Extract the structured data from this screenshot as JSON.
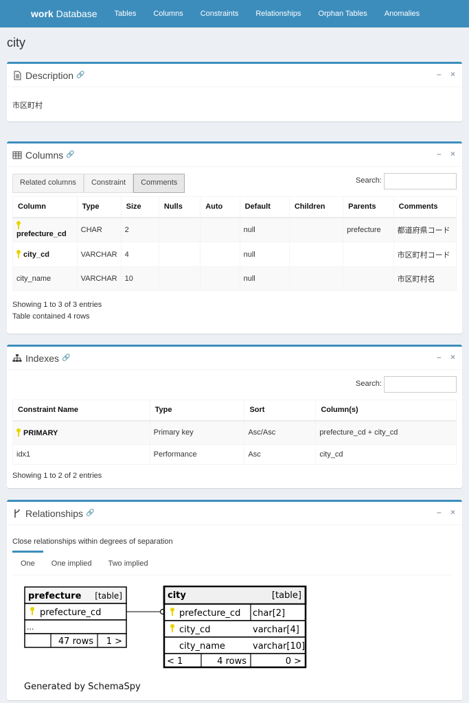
{
  "nav": {
    "brand_bold": "work",
    "brand_rest": " Database",
    "items": [
      "Tables",
      "Columns",
      "Constraints",
      "Relationships",
      "Orphan Tables",
      "Anomalies"
    ]
  },
  "page_title": "city",
  "description": {
    "title": "Description",
    "text": "市区町村"
  },
  "columns": {
    "title": "Columns",
    "buttons": [
      "Related columns",
      "Constraint",
      "Comments"
    ],
    "active_button": "Comments",
    "search_label": "Search:",
    "headers": [
      "Column",
      "Type",
      "Size",
      "Nulls",
      "Auto",
      "Default",
      "Children",
      "Parents",
      "Comments"
    ],
    "rows": [
      {
        "column": "prefecture_cd",
        "type": "CHAR",
        "size": "2",
        "nulls": "",
        "auto": "",
        "default": "null",
        "children": "",
        "parents": "prefecture",
        "comments": "都道府県コード"
      },
      {
        "column": "city_cd",
        "type": "VARCHAR",
        "size": "4",
        "nulls": "",
        "auto": "",
        "default": "null",
        "children": "",
        "parents": "",
        "comments": "市区町村コード"
      },
      {
        "column": "city_name",
        "type": "VARCHAR",
        "size": "10",
        "nulls": "",
        "auto": "",
        "default": "null",
        "children": "",
        "parents": "",
        "comments": "市区町村名"
      }
    ],
    "info1": "Showing 1 to 3 of 3 entries",
    "info2": "Table contained 4 rows"
  },
  "indexes": {
    "title": "Indexes",
    "search_label": "Search:",
    "headers": [
      "Constraint Name",
      "Type",
      "Sort",
      "Column(s)"
    ],
    "rows": [
      {
        "name": "PRIMARY",
        "type": "Primary key",
        "sort": "Asc/Asc",
        "columns": "prefecture_cd + city_cd"
      },
      {
        "name": "idx1",
        "type": "Performance",
        "sort": "Asc",
        "columns": "city_cd"
      }
    ],
    "info": "Showing 1 to 2 of 2 entries"
  },
  "relationships": {
    "title": "Relationships",
    "caption": "Close relationships within degrees of separation",
    "tabs": [
      "One",
      "One implied",
      "Two implied"
    ],
    "active_tab": "One",
    "parent_table": {
      "name": "prefecture",
      "kind": "[table]",
      "column": "prefecture_cd",
      "ellipsis": "...",
      "rows": "47 rows",
      "children": "1 >"
    },
    "child_table": {
      "name": "city",
      "kind": "[table]",
      "columns": [
        {
          "name": "prefecture_cd",
          "type": "char[2]"
        },
        {
          "name": "city_cd",
          "type": "varchar[4]"
        },
        {
          "name": "city_name",
          "type": "varchar[10]"
        }
      ],
      "parents": "< 1",
      "rows": "4 rows",
      "children": "0 >"
    },
    "generated_by": "Generated by SchemaSpy"
  },
  "tools": {
    "collapse": "–",
    "close": "×"
  },
  "colors": {
    "accent": "#3c8dbc",
    "key": "#e8d400"
  }
}
